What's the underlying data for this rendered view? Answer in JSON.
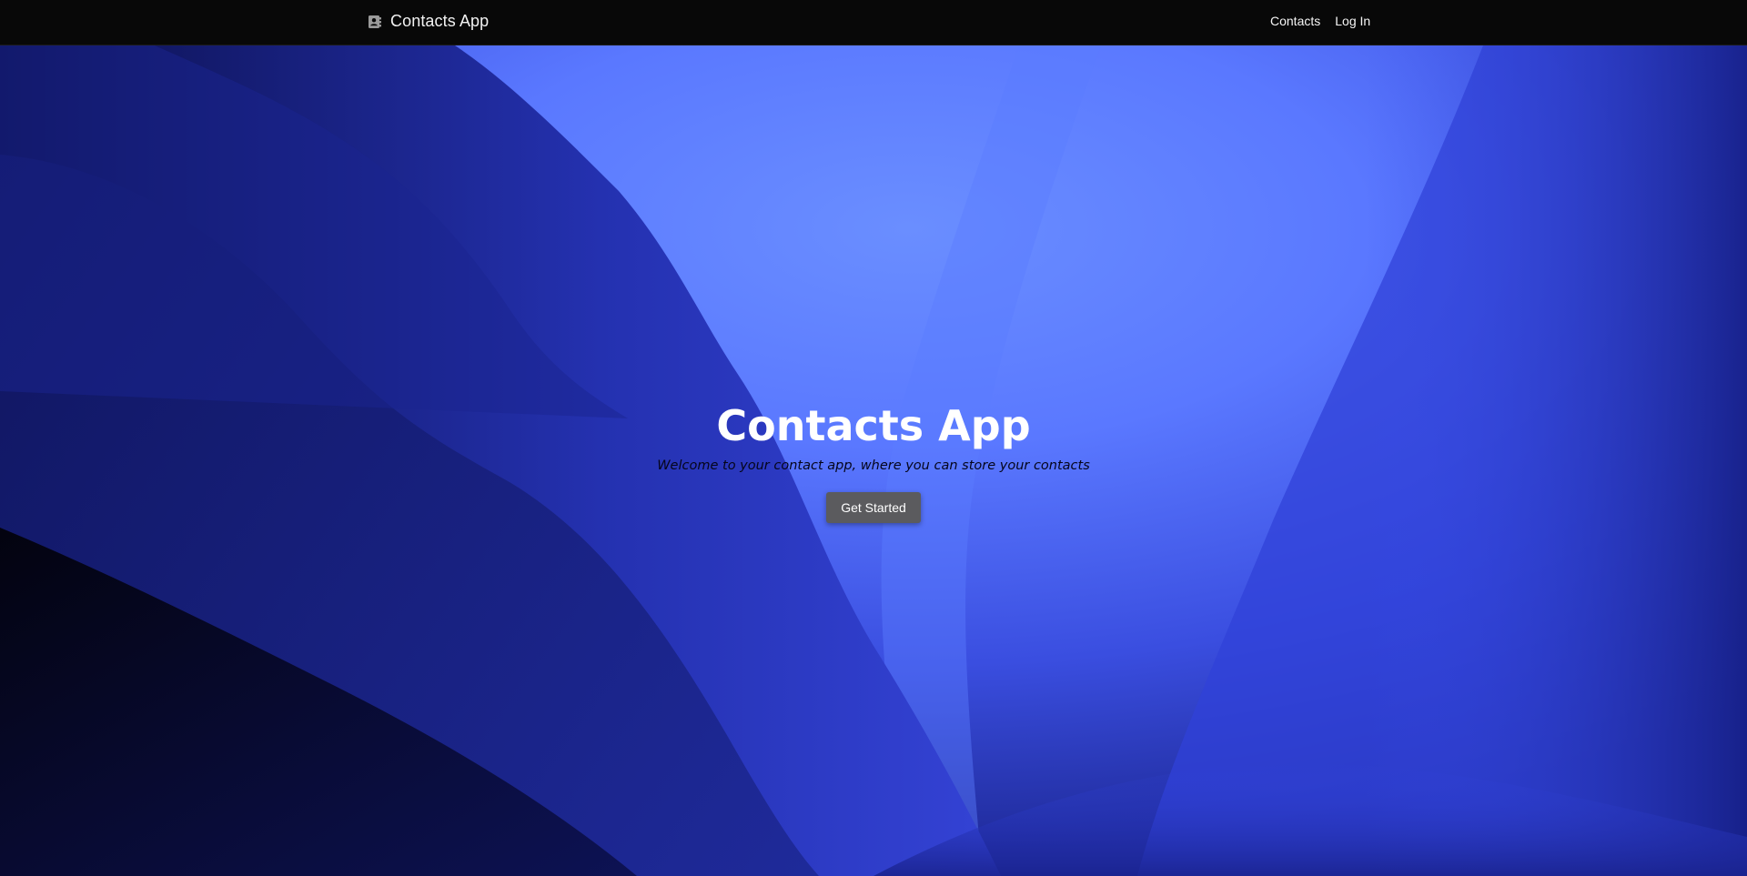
{
  "navbar": {
    "brand_icon": "contact-card-icon",
    "brand_label": "Contacts App",
    "links": [
      {
        "label": "Contacts"
      },
      {
        "label": "Log In"
      }
    ]
  },
  "hero": {
    "title": "Contacts App",
    "subtitle": "Welcome to your contact app, where you can store your contacts",
    "cta_label": "Get Started"
  },
  "colors": {
    "navbar_bg": "#080808",
    "hero_light": "#6488ff",
    "hero_mid": "#3346dc",
    "hero_dark": "#0a0c3a",
    "button_bg": "#5b5b5e"
  }
}
